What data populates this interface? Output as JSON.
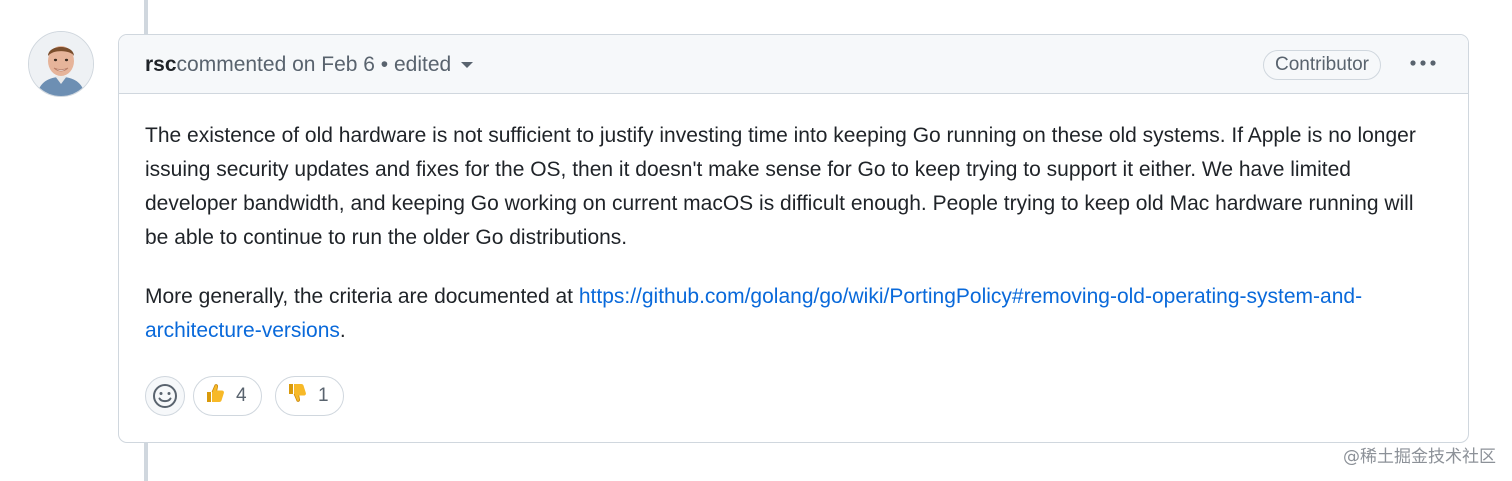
{
  "comment": {
    "author": "rsc",
    "action_text": " commented on Feb 6 • edited",
    "role_badge": "Contributor",
    "menu_icon": "kebab-horizontal-icon",
    "body": {
      "paragraph1": "The existence of old hardware is not sufficient to justify investing time into keeping Go running on these old systems. If Apple is no longer issuing security updates and fixes for the OS, then it doesn't make sense for Go to keep trying to support it either. We have limited developer bandwidth, and keeping Go working on current macOS is difficult enough. People trying to keep old Mac hardware running will be able to continue to run the older Go distributions.",
      "paragraph2_prefix": "More generally, the criteria are documented at ",
      "link_text": "https://github.com/golang/go/wiki/PortingPolicy#removing-old-operating-system-and-architecture-versions",
      "paragraph2_suffix": "."
    },
    "reactions": {
      "add_icon": "smiley-icon",
      "thumbs_up": {
        "icon": "thumbs-up-icon",
        "count": "4"
      },
      "thumbs_down": {
        "icon": "thumbs-down-icon",
        "count": "1"
      }
    }
  },
  "watermark": "@稀土掘金技术社区",
  "colors": {
    "link": "#0969da",
    "border": "#d0d7de",
    "header_bg": "#f6f8fa",
    "muted_text": "#59636e"
  }
}
